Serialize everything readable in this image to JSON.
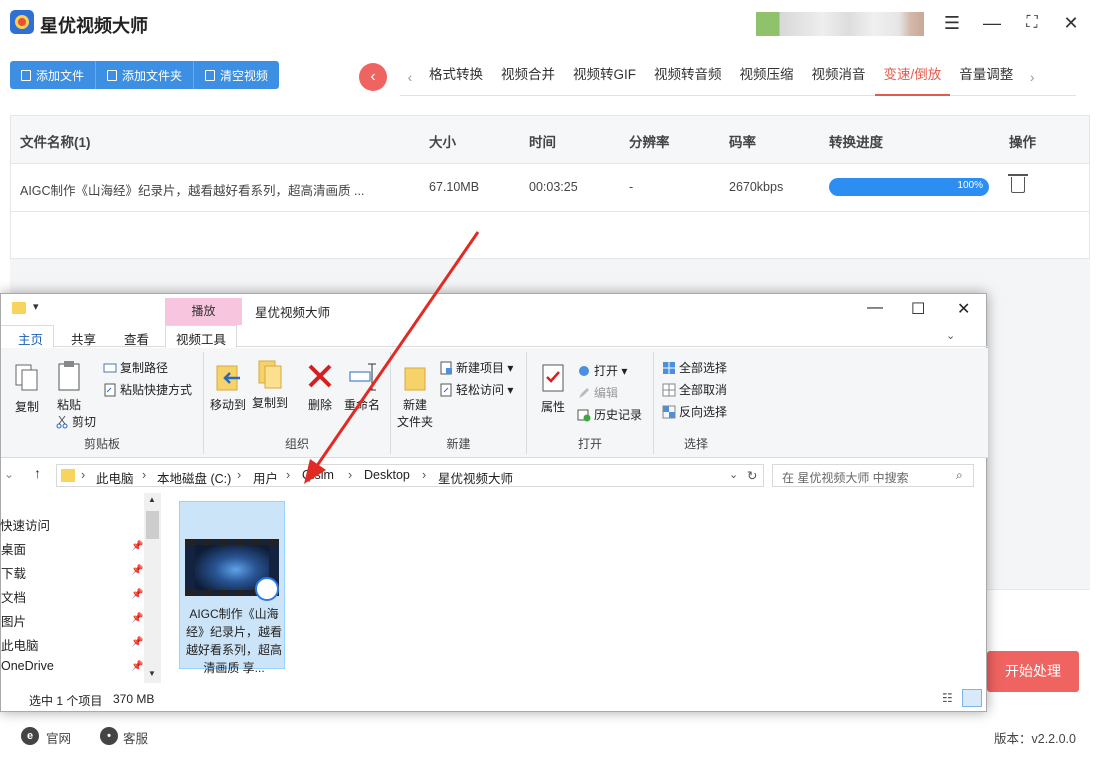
{
  "app": {
    "title": "星优视频大师",
    "version_label": "版本：v2.2.0.0"
  },
  "toolbar": {
    "add_file": "添加文件",
    "add_folder": "添加文件夹",
    "clear": "清空视频"
  },
  "tabs": [
    "格式转换",
    "视频合并",
    "视频转GIF",
    "视频转音频",
    "视频压缩",
    "视频消音",
    "变速/倒放",
    "音量调整"
  ],
  "active_tab": "变速/倒放",
  "table": {
    "headers": [
      "文件名称(1)",
      "大小",
      "时间",
      "分辨率",
      "码率",
      "转换进度",
      "操作"
    ],
    "rows": [
      {
        "name": "AIGC制作《山海经》纪录片，越看越好看系列，超高清画质 ...",
        "size": "67.10MB",
        "duration": "00:03:25",
        "resolution": "-",
        "bitrate": "2670kbps",
        "progress_label": "100%",
        "progress": 1.0
      }
    ]
  },
  "start_button": "开始处理",
  "footer": {
    "site": "官网",
    "service": "客服"
  },
  "explorer": {
    "ctx_tab": "播放",
    "title": "星优视频大师",
    "ribbon_tabs": {
      "home": "主页",
      "share": "共享",
      "view": "查看",
      "video_tools": "视频工具"
    },
    "clipboard": {
      "copy": "复制",
      "paste": "粘贴",
      "copy_path": "复制路径",
      "paste_shortcut": "粘贴快捷方式",
      "cut": "剪切",
      "label": "剪贴板"
    },
    "organize": {
      "move_to": "移动到",
      "copy_to": "复制到",
      "delete": "删除",
      "rename": "重命名",
      "label": "组织"
    },
    "new": {
      "new_folder_1": "新建",
      "new_folder_2": "文件夹",
      "new_item": "新建项目",
      "easy_access": "轻松访问",
      "label": "新建"
    },
    "open": {
      "properties": "属性",
      "open": "打开",
      "edit": "编辑",
      "history": "历史记录",
      "label": "打开"
    },
    "select": {
      "all": "全部选择",
      "none": "全部取消",
      "invert": "反向选择",
      "label": "选择"
    },
    "address": [
      "此电脑",
      "本地磁盘 (C:)",
      "用户",
      "Qisim",
      "Desktop",
      "星优视频大师"
    ],
    "search_placeholder": "在 星优视频大师 中搜索",
    "nav": [
      "快速访问",
      "桌面",
      "下载",
      "文档",
      "图片",
      "此电脑",
      "OneDrive"
    ],
    "file_name": "AIGC制作《山海经》纪录片，越看越好看系列，超高清画质 享...",
    "status": {
      "selected": "选中 1 个项目",
      "size": "370 MB"
    }
  }
}
